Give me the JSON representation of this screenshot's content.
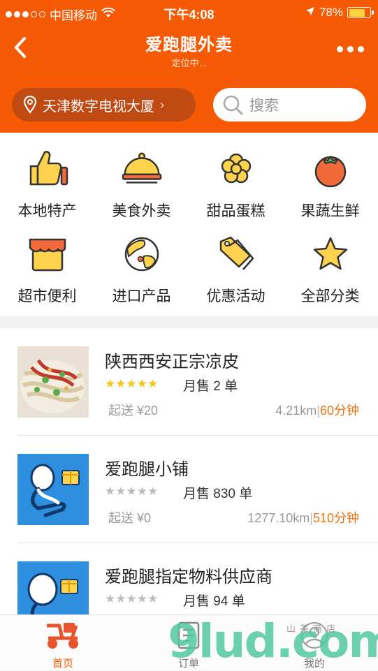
{
  "status_bar": {
    "carrier": "中国移动",
    "time": "下午4:08",
    "battery": "78%",
    "battery_level": 0.78
  },
  "nav": {
    "title": "爱跑腿外卖",
    "subtitle": "定位中..."
  },
  "location": {
    "label": "天津数字电视大厦"
  },
  "search": {
    "placeholder": "搜索"
  },
  "categories": [
    {
      "label": "本地特产",
      "icon": "thumbs-up-icon"
    },
    {
      "label": "美食外卖",
      "icon": "food-cover-icon"
    },
    {
      "label": "甜品蛋糕",
      "icon": "flower-icon"
    },
    {
      "label": "果蔬生鲜",
      "icon": "tomato-icon"
    },
    {
      "label": "超市便利",
      "icon": "store-icon"
    },
    {
      "label": "进口产品",
      "icon": "globe-icon"
    },
    {
      "label": "优惠活动",
      "icon": "tag-icon"
    },
    {
      "label": "全部分类",
      "icon": "star-icon"
    }
  ],
  "stores": [
    {
      "name": "陕西西安正宗凉皮",
      "rating": 5,
      "sales": "月售 2 单",
      "min_order": "起送 ¥20",
      "distance": "4.21km",
      "separator": "|",
      "time": "60分钟",
      "thumb": "noodle-photo"
    },
    {
      "name": "爱跑腿小铺",
      "rating": 0,
      "sales": "月售 830 单",
      "min_order": "起送 ¥0",
      "distance": "1277.10km",
      "separator": "|",
      "time": "510分钟",
      "thumb": "runner-logo"
    },
    {
      "name": "爱跑腿指定物料供应商",
      "rating": 0,
      "sales": "月售 94 单",
      "min_order": "",
      "distance": "",
      "separator": "",
      "time": "",
      "thumb": "runner-logo"
    }
  ],
  "tabs": [
    {
      "label": "首页",
      "icon": "scooter-icon",
      "active": true
    },
    {
      "label": "订单",
      "icon": "order-icon",
      "active": false
    },
    {
      "label": "我的",
      "icon": "user-icon",
      "active": false
    }
  ],
  "watermark": {
    "text": "9lud.com",
    "sub": "山茶商店"
  },
  "colors": {
    "brand": "#f75a05",
    "accent_time": "#f0720f",
    "star_on": "#f5c518",
    "star_off": "#bdbdbd"
  }
}
